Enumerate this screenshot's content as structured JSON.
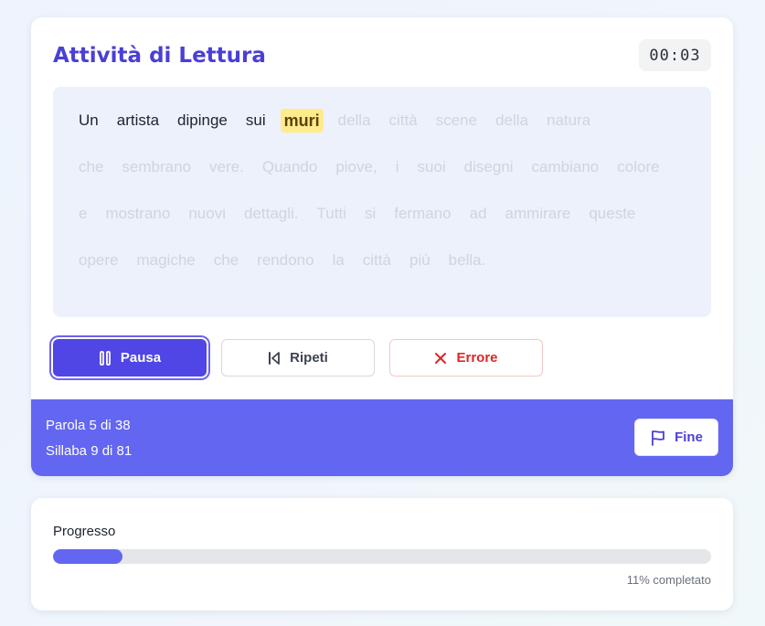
{
  "activity": {
    "title": "Attività di Lettura",
    "timer": "00:03"
  },
  "reading": {
    "current_index": 4,
    "lines": [
      [
        "Un",
        "artista",
        "dipinge",
        "sui",
        "muri",
        "della",
        "città",
        "scene",
        "della",
        "natura"
      ],
      [
        "che",
        "sembrano",
        "vere.",
        "Quando",
        "piove,",
        "i",
        "suoi",
        "disegni",
        "cambiano",
        "colore"
      ],
      [
        "e",
        "mostrano",
        "nuovi",
        "dettagli.",
        "Tutti",
        "si",
        "fermano",
        "ad",
        "ammirare",
        "queste"
      ],
      [
        "opere",
        "magiche",
        "che",
        "rendono",
        "la",
        "città",
        "più",
        "bella."
      ]
    ]
  },
  "controls": {
    "pause_label": "Pausa",
    "repeat_label": "Ripeti",
    "error_label": "Errore"
  },
  "status": {
    "word_progress": "Parola 5 di 38",
    "syllable_progress": "Sillaba 9 di 81",
    "finish_label": "Fine"
  },
  "progress": {
    "label": "Progresso",
    "fraction": 0.105,
    "percent_text": "11% completato"
  },
  "colors": {
    "accent": "#4f46e5",
    "footer": "#6366f1",
    "highlight": "#fdeb8c",
    "error": "#dc2626"
  }
}
